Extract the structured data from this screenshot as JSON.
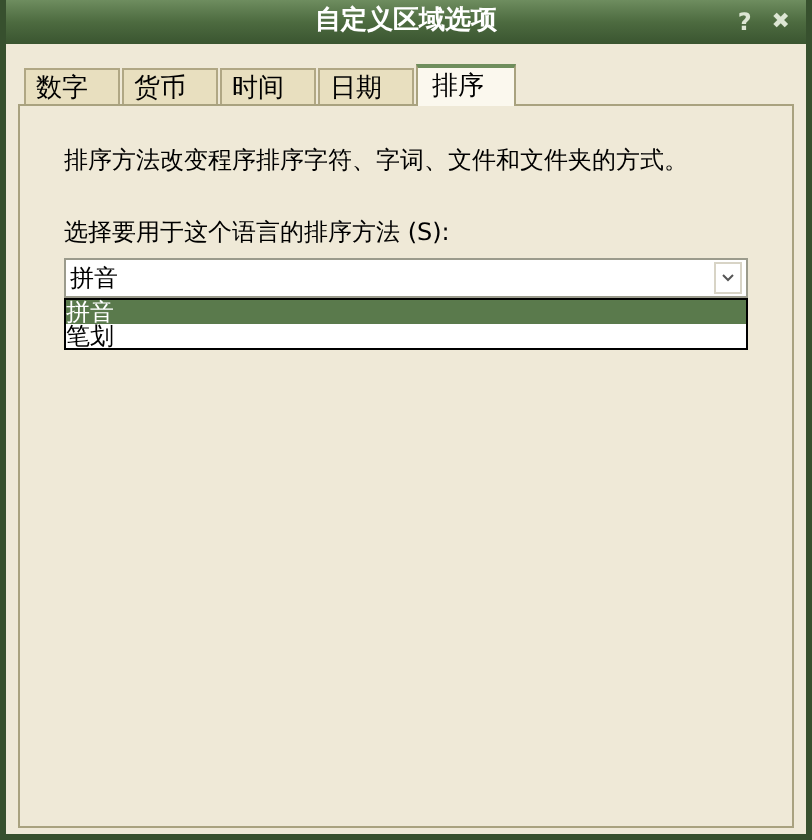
{
  "window": {
    "title": "自定义区域选项",
    "help_button": "?",
    "close_button": "✖"
  },
  "tabs": [
    {
      "label": "数字",
      "selected": false
    },
    {
      "label": "货币",
      "selected": false
    },
    {
      "label": "时间",
      "selected": false
    },
    {
      "label": "日期",
      "selected": false
    },
    {
      "label": "排序",
      "selected": true
    }
  ],
  "description": "排序方法改变程序排序字符、字词、文件和文件夹的方式。",
  "sort_method": {
    "label": "选择要用于这个语言的排序方法 (S):",
    "value": "拼音",
    "expanded": true,
    "options": [
      {
        "label": "拼音",
        "selected": true
      },
      {
        "label": "笔划",
        "selected": false
      }
    ]
  }
}
